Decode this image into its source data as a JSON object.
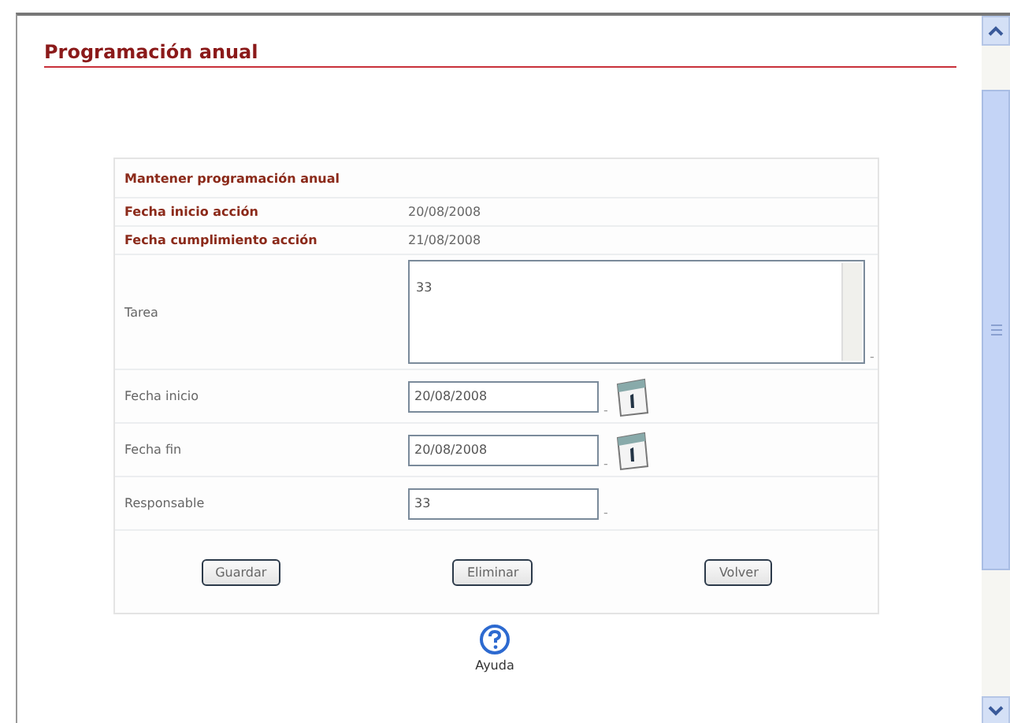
{
  "page": {
    "title": "Programación anual"
  },
  "form": {
    "heading": "Mantener programación anual",
    "info": [
      {
        "label": "Fecha inicio acción",
        "value": "20/08/2008"
      },
      {
        "label": "Fecha cumplimiento acción",
        "value": "21/08/2008"
      }
    ],
    "fields": [
      {
        "kind": "textarea",
        "label": "Tarea",
        "value": "33",
        "suffix": "-"
      },
      {
        "kind": "date",
        "label": "Fecha inicio",
        "value": "20/08/2008",
        "suffix": "-"
      },
      {
        "kind": "date",
        "label": "Fecha fin",
        "value": "20/08/2008",
        "suffix": "-"
      },
      {
        "kind": "text",
        "label": "Responsable",
        "value": "33",
        "suffix": "-"
      }
    ],
    "buttons": [
      "Guardar",
      "Eliminar",
      "Volver"
    ]
  },
  "help": {
    "label": "Ayuda"
  }
}
